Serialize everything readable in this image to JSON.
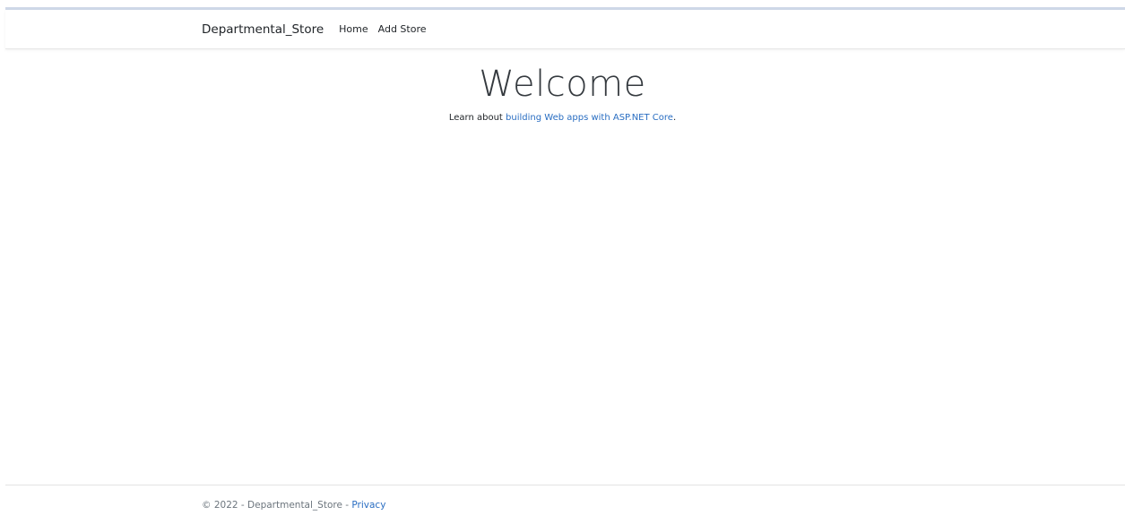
{
  "navbar": {
    "brand": "Departmental_Store",
    "links": [
      "Home",
      "Add Store"
    ]
  },
  "main": {
    "heading": "Welcome",
    "learn_prefix": "Learn about ",
    "learn_link": "building Web apps with ASP.NET Core",
    "learn_suffix": "."
  },
  "footer": {
    "copyright": "© 2022 - Departmental_Store - ",
    "privacy_link": "Privacy"
  },
  "colors": {
    "link": "#2a6ec2",
    "text": "#212529",
    "muted": "#6c757d",
    "top_accent": "#cfd8e8"
  }
}
